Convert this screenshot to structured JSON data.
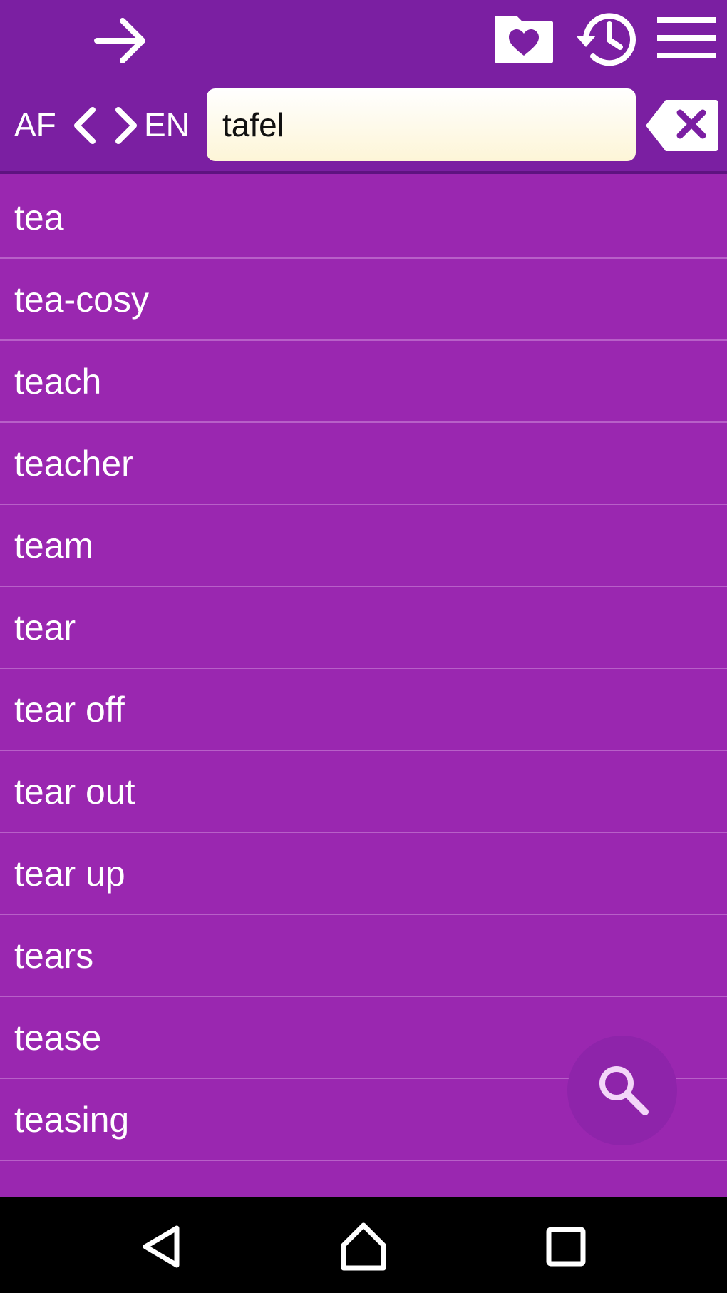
{
  "header": {
    "icons": {
      "forward": "arrow-right-icon",
      "favorites": "folder-heart-icon",
      "history": "history-clock-icon",
      "menu": "hamburger-menu-icon"
    },
    "lang_from": "AF",
    "lang_to": "EN",
    "search_value": "tafel",
    "clear_icon": "backspace-clear-icon"
  },
  "word_list": {
    "items": [
      "tea",
      "tea-cosy",
      "teach",
      "teacher",
      "team",
      "tear",
      "tear off",
      "tear out",
      "tear up",
      "tears",
      "tease",
      "teasing"
    ]
  },
  "fab": {
    "icon": "search-icon"
  },
  "system_nav": {
    "icons": [
      "back-triangle-icon",
      "home-icon",
      "recent-apps-icon"
    ]
  },
  "colors": {
    "header_bg": "#7b1fa2",
    "list_bg": "#9a27b0",
    "divider": "#b85fc8",
    "fab_bg": "#8e24aa",
    "search_bg": "#fdf5d7"
  }
}
